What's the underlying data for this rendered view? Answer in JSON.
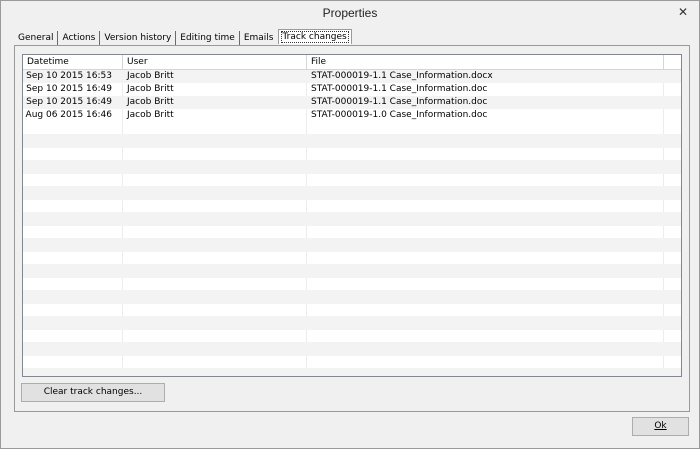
{
  "window": {
    "title": "Properties",
    "close_glyph": "✕"
  },
  "tabs": [
    {
      "label": "General",
      "active": false
    },
    {
      "label": "Actions",
      "active": false
    },
    {
      "label": "Version history",
      "active": false
    },
    {
      "label": "Editing time",
      "active": false
    },
    {
      "label": "Emails",
      "active": false
    },
    {
      "label": "Track changes",
      "active": true
    }
  ],
  "table": {
    "columns": [
      "Datetime",
      "User",
      "File"
    ],
    "rows": [
      {
        "datetime": "Sep 10 2015 16:53",
        "user": "Jacob Britt",
        "file": "STAT-000019-1.1 Case_Information.docx"
      },
      {
        "datetime": "Sep 10 2015 16:49",
        "user": "Jacob Britt",
        "file": "STAT-000019-1.1 Case_Information.doc"
      },
      {
        "datetime": "Sep 10 2015 16:49",
        "user": "Jacob Britt",
        "file": "STAT-000019-1.1 Case_Information.doc"
      },
      {
        "datetime": "Aug 06 2015 16:46",
        "user": "Jacob Britt",
        "file": "STAT-000019-1.0 Case_Information.doc"
      }
    ]
  },
  "buttons": {
    "clear": "Clear track changes...",
    "ok": "Ok"
  }
}
